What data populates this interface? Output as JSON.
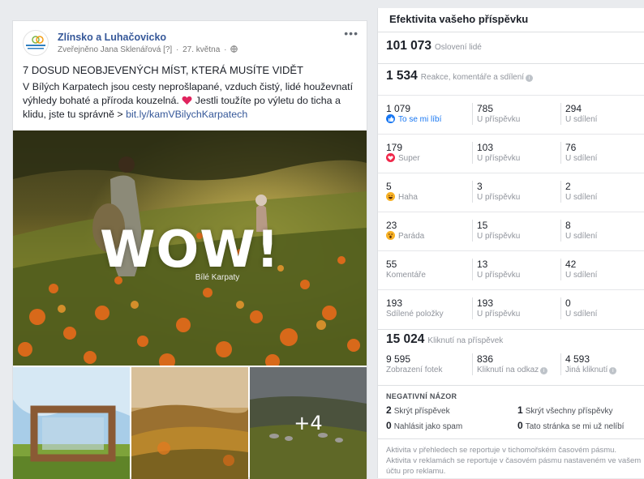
{
  "post": {
    "page_name": "Zlínsko a Luhačovicko",
    "avatar_label": "Zlínsko a Luhačovicko",
    "published_by": "Zveřejněno Jana Sklenářová",
    "help_marker": "[?]",
    "date": "27. května",
    "more_label": "•••",
    "headline": "7 DOSUD NEOBJEVENÝCH MÍST, KTERÁ MUSÍTE VIDĚT",
    "body": "V Bílých Karpatech jsou cesty neprošlapané, vzduch čistý, lidé houževnatí výhledy bohaté a příroda kouzelná.",
    "body_after_heart": " Jestli toužíte po výletu do ticha a klidu, jste tu správně > ",
    "link": "bit.ly/kamVBilychKarpatech",
    "photo_title": "WOW!",
    "photo_subtitle": "Bílé Karpaty",
    "more_photos": "+4"
  },
  "panel": {
    "title": "Efektivita vašeho příspěvku",
    "reach": {
      "value": "101 073",
      "label": "Oslovení lidé"
    },
    "engagement": {
      "value": "1 534",
      "label": "Reakce, komentáře a sdílení"
    },
    "rows": [
      {
        "icon": "like",
        "total": "1 079",
        "label": "To se mi líbí",
        "on_post": "785",
        "on_post_label": "U příspěvku",
        "on_shares": "294",
        "on_shares_label": "U sdílení"
      },
      {
        "icon": "love",
        "total": "179",
        "label": "Super",
        "on_post": "103",
        "on_post_label": "U příspěvku",
        "on_shares": "76",
        "on_shares_label": "U sdílení"
      },
      {
        "icon": "haha",
        "total": "5",
        "label": "Haha",
        "on_post": "3",
        "on_post_label": "U příspěvku",
        "on_shares": "2",
        "on_shares_label": "U sdílení"
      },
      {
        "icon": "wow",
        "total": "23",
        "label": "Paráda",
        "on_post": "15",
        "on_post_label": "U příspěvku",
        "on_shares": "8",
        "on_shares_label": "U sdílení"
      },
      {
        "icon": "",
        "total": "55",
        "label": "Komentáře",
        "on_post": "13",
        "on_post_label": "U příspěvku",
        "on_shares": "42",
        "on_shares_label": "U sdílení"
      },
      {
        "icon": "",
        "total": "193",
        "label": "Sdílené položky",
        "on_post": "193",
        "on_post_label": "U příspěvku",
        "on_shares": "0",
        "on_shares_label": "U sdílení"
      }
    ],
    "clicks": {
      "value": "15 024",
      "label": "Kliknutí na příspěvek"
    },
    "click_breakdown": [
      {
        "value": "9 595",
        "label": "Zobrazení fotek"
      },
      {
        "value": "836",
        "label": "Kliknutí na odkaz"
      },
      {
        "value": "4 593",
        "label": "Jiná kliknutí"
      }
    ],
    "negative": {
      "title": "NEGATIVNÍ NÁZOR",
      "items": [
        {
          "value": "2",
          "label": "Skrýt příspěvek"
        },
        {
          "value": "1",
          "label": "Skrýt všechny příspěvky"
        },
        {
          "value": "0",
          "label": "Nahlásit jako spam"
        },
        {
          "value": "0",
          "label": "Tato stránka se mi už nelíbí"
        }
      ]
    },
    "footnote": "Aktivita v přehledech se reportuje v tichomořském časovém pásmu. Aktivita v reklamách se reportuje v časovém pásmu nastaveném ve vašem účtu pro reklamu.",
    "info_glyph": "i"
  },
  "colors": {
    "link": "#365899",
    "like": "#1877f2",
    "love": "#f0284a",
    "haha": "#f7b125"
  }
}
